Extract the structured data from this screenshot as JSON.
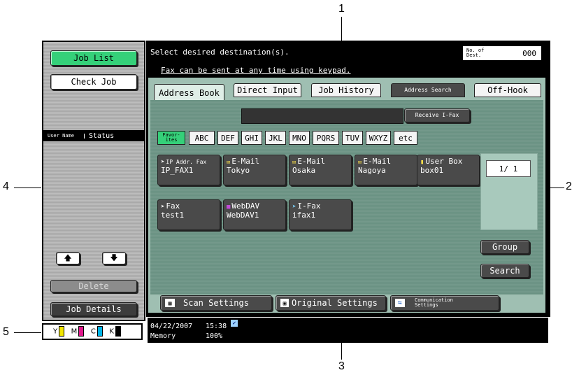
{
  "callouts": {
    "c1": "1",
    "c2": "2",
    "c3": "3",
    "c4": "4",
    "c5": "5"
  },
  "left_panel": {
    "job_list": "Job List",
    "check_job": "Check Job",
    "col_user_name": "User Name",
    "col_status": "Status",
    "delete": "Delete",
    "job_details": "Job Details"
  },
  "header": {
    "message": "Select desired destination(s).",
    "sub_message": "Fax can be sent at any time using keypad.",
    "dest_label": "No. of Dest.",
    "dest_count": "000"
  },
  "tabs": {
    "address_book": "Address Book",
    "direct_input": "Direct Input",
    "job_history": "Job History",
    "address_search": "Address Search",
    "off_hook": "Off-Hook"
  },
  "receive_ifax": "Receive I-Fax",
  "index_keys": [
    "Favor- ites",
    "ABC",
    "DEF",
    "GHI",
    "JKL",
    "MNO",
    "PQRS",
    "TUV",
    "WXYZ",
    "etc"
  ],
  "destinations": [
    {
      "type": "IP Addr. Fax",
      "name": "IP_FAX1",
      "icon": "ip-fax-icon"
    },
    {
      "type": "E-Mail",
      "name": "Tokyo",
      "icon": "email-icon"
    },
    {
      "type": "E-Mail",
      "name": "Osaka",
      "icon": "email-icon"
    },
    {
      "type": "E-Mail",
      "name": "Nagoya",
      "icon": "email-icon"
    },
    {
      "type": "User Box",
      "name": "box01",
      "icon": "user-box-icon"
    },
    {
      "type": "Fax",
      "name": "test1",
      "icon": "fax-icon"
    },
    {
      "type": "WebDAV",
      "name": "WebDAV1",
      "icon": "webdav-icon"
    },
    {
      "type": "I-Fax",
      "name": "ifax1",
      "icon": "ifax-icon"
    }
  ],
  "page_indicator": "1/ 1",
  "group": "Group",
  "search": "Search",
  "bottom_buttons": {
    "scan_settings": "Scan Settings",
    "original_settings": "Original Settings",
    "communication_settings": "Communication Settings"
  },
  "status_bar": {
    "date": "04/22/2007",
    "time": "15:38",
    "memory_label": "Memory",
    "memory_value": "100%"
  },
  "toner": [
    {
      "label": "Y",
      "color": "#f2e600"
    },
    {
      "label": "M",
      "color": "#e0188c"
    },
    {
      "label": "C",
      "color": "#00b4e6"
    },
    {
      "label": "K",
      "color": "#000000"
    }
  ]
}
